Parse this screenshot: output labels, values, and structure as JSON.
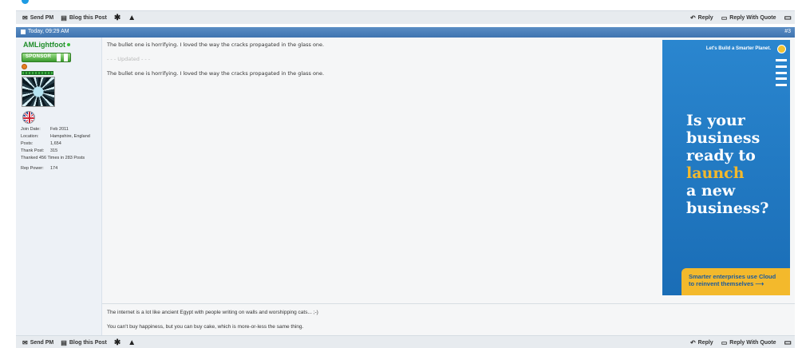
{
  "top_bar": {
    "send_pm": "Send PM",
    "blog_post": "Blog this Post",
    "reply": "Reply",
    "reply_quote": "Reply With Quote"
  },
  "post": {
    "date": "Today, 09:29 AM",
    "number": "#3",
    "user": {
      "name": "AMLightfoot",
      "badge": "SPONSOR",
      "stats": [
        {
          "label": "Join Date:",
          "value": "Feb 2011"
        },
        {
          "label": "Location:",
          "value": "Hampshire, England"
        },
        {
          "label": "Posts:",
          "value": "1,654"
        },
        {
          "label": "Thank Post:",
          "value": "315"
        }
      ],
      "thanked": "Thanked 456 Times in 283 Posts",
      "rep_label": "Rep Power:",
      "rep_value": "174"
    },
    "message_1": "The bullet one is horrifying. I loved the way the cracks propagated in the glass one.",
    "updated_marker": "- - - Updated - - -",
    "message_2": "The bullet one is horrifying. I loved the way the cracks propagated in the glass one.",
    "signature_1": "The internet is a lot like ancient Egypt with people writing on walls and worshipping cats... ;-)",
    "signature_2": "You can't buy happiness, but you can buy cake, which is more-or-less the same thing."
  },
  "ad": {
    "tagline": "Let's Build a Smarter Planet.",
    "line1": "Is your",
    "line2": "business",
    "line3": "ready to",
    "line4": "launch",
    "line5": "a new",
    "line6": "business?",
    "cta_line1": "Smarter enterprises use Cloud",
    "cta_line2": "to reinvent themselves",
    "colors": {
      "bg": "#1f78c4",
      "accent": "#f3b92c"
    }
  },
  "bottom_bar": {
    "send_pm": "Send PM",
    "blog_post": "Blog this Post",
    "reply": "Reply",
    "reply_quote": "Reply With Quote"
  }
}
